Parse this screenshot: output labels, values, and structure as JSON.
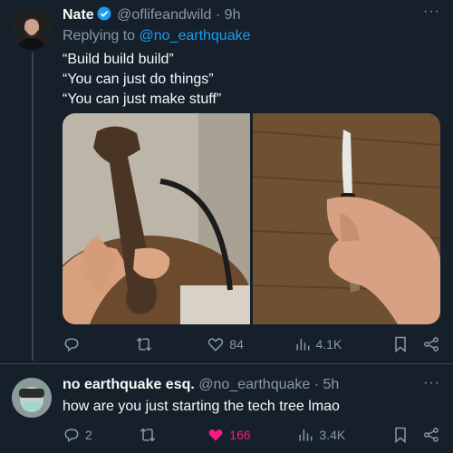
{
  "tweet1": {
    "author_name": "Nate",
    "handle": "@oflifeandwild",
    "separator": "·",
    "time": "9h",
    "replying_prefix": "Replying to ",
    "replying_to": "@no_earthquake",
    "lines": [
      "“Build build build”",
      "“You can just do things”",
      "“You can just make stuff”"
    ],
    "metrics": {
      "reply": "",
      "retweet": "",
      "likes": "84",
      "views": "4.1K"
    }
  },
  "tweet2": {
    "author_name": "no earthquake esq.",
    "handle": "@no_earthquake",
    "separator": "·",
    "time": "5h",
    "text": "how are you just starting the tech tree lmao",
    "metrics": {
      "reply": "2",
      "retweet": "",
      "likes": "166",
      "views": "3.4K"
    }
  },
  "more_label": "···",
  "colors": {
    "background": "#15202b",
    "text": "#f7f9f9",
    "muted": "#8b98a5",
    "link": "#1d9bf0",
    "like": "#f91880"
  }
}
